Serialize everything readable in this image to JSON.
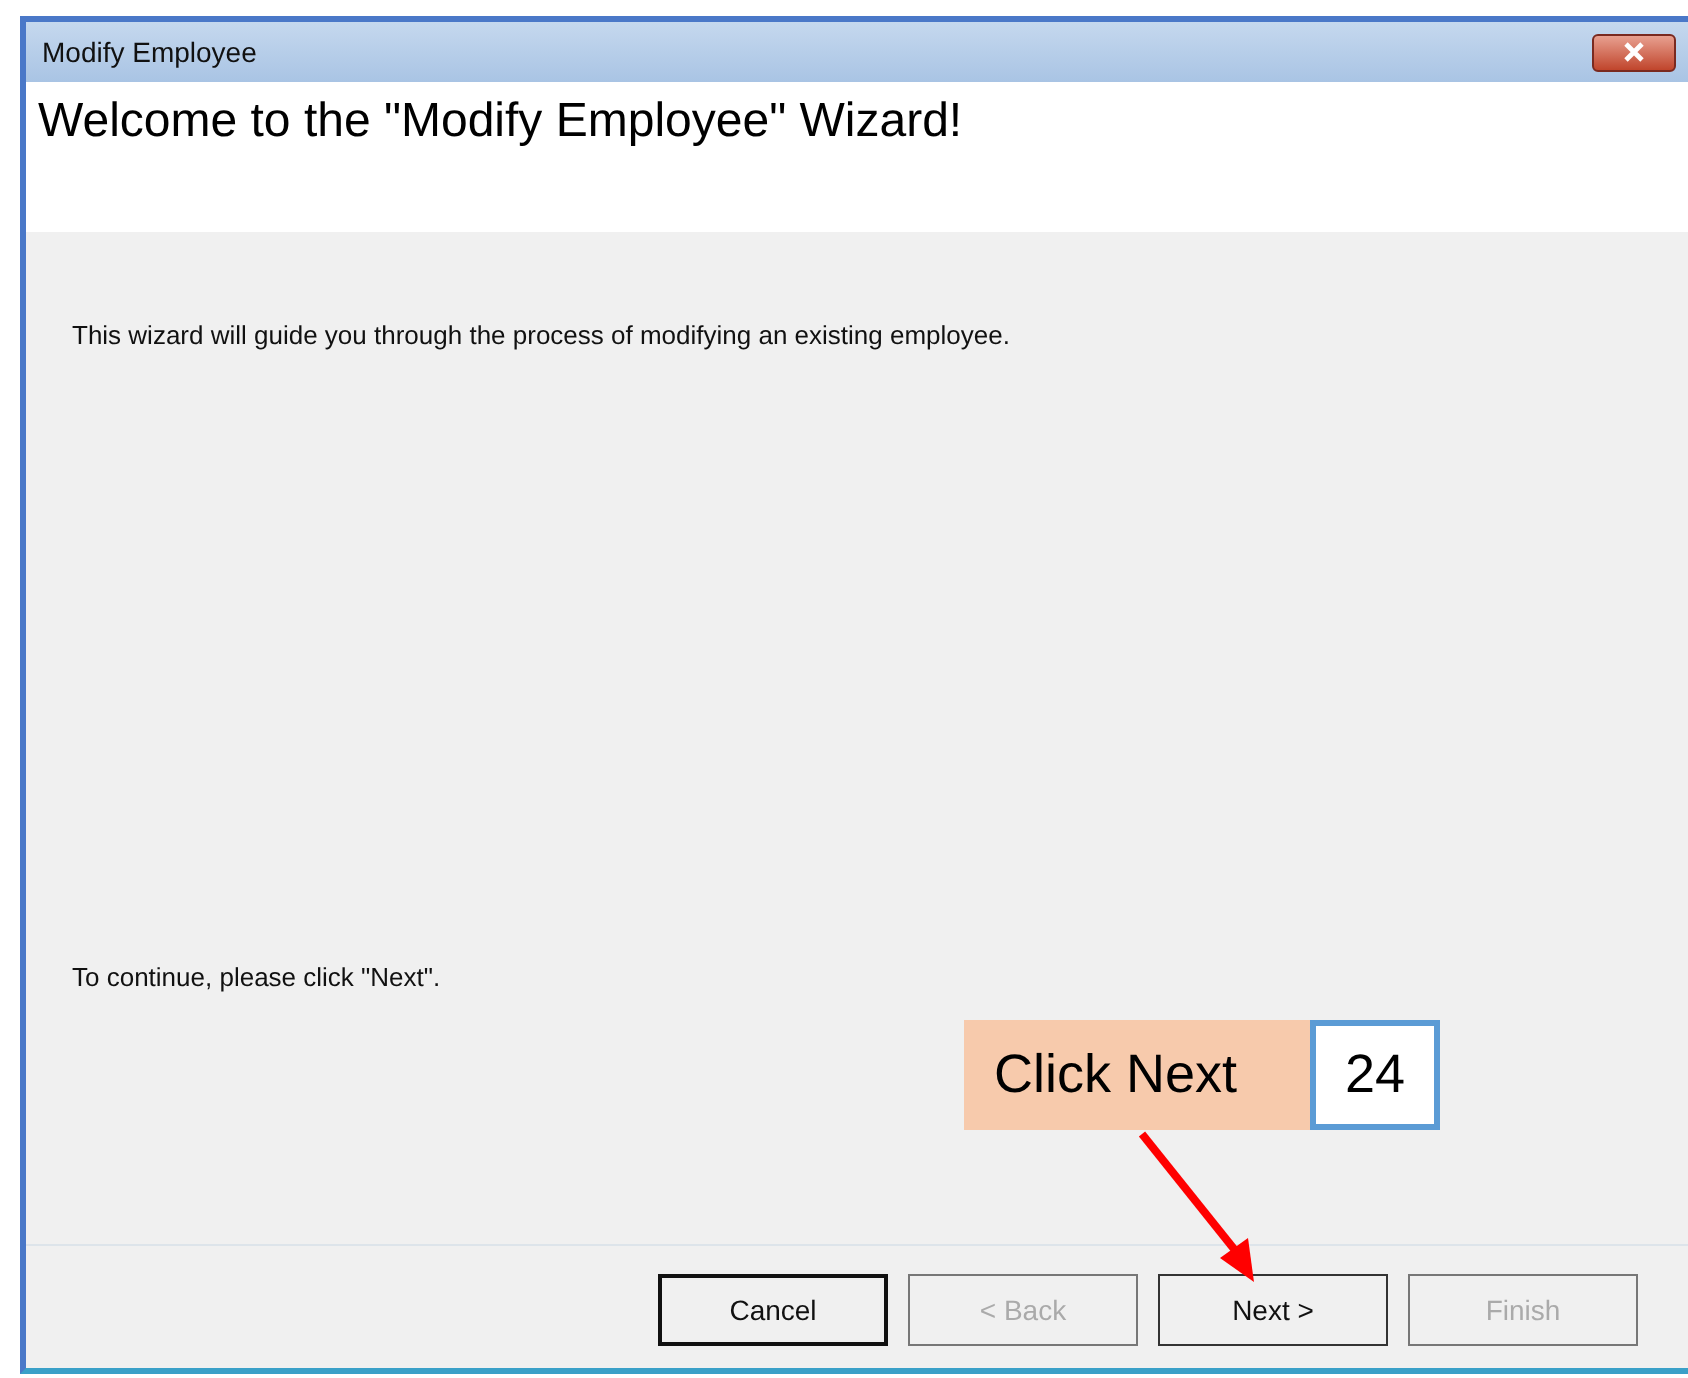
{
  "window": {
    "title": "Modify Employee"
  },
  "header": {
    "title": "Welcome to the \"Modify Employee\" Wizard!"
  },
  "body": {
    "intro": "This wizard will guide you through the process of modifying an existing employee.",
    "continue": "To continue, please click \"Next\"."
  },
  "buttons": [
    {
      "label": "Cancel",
      "disabled": false,
      "default": true
    },
    {
      "label": "< Back",
      "disabled": true,
      "default": false
    },
    {
      "label": "Next >",
      "disabled": false,
      "default": false
    },
    {
      "label": "Finish",
      "disabled": true,
      "default": false
    }
  ],
  "callout": {
    "text": "Click Next",
    "step": "24"
  }
}
